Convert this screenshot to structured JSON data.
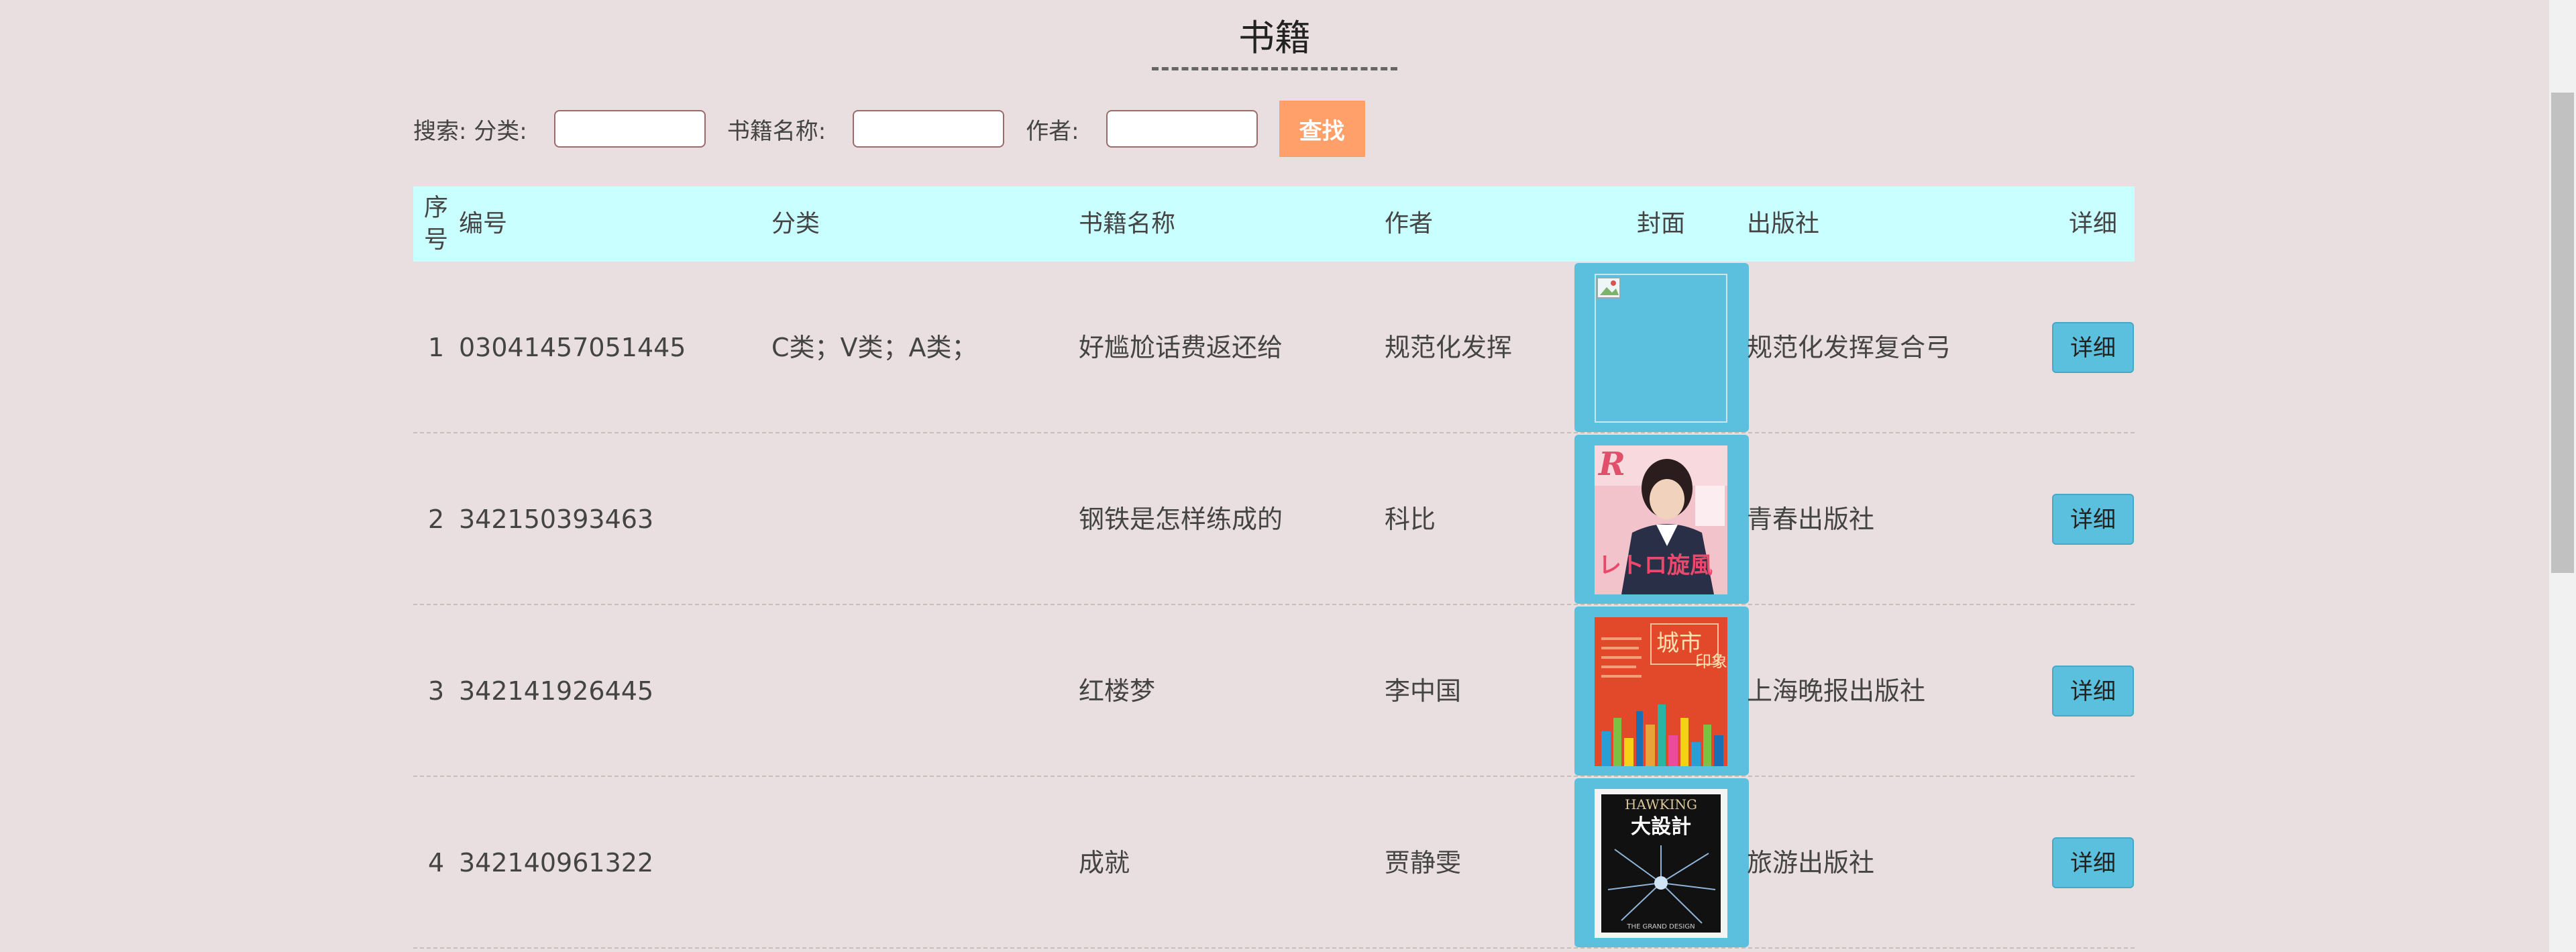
{
  "page": {
    "title": "书籍"
  },
  "search": {
    "prefix_label": "搜索: 分类:",
    "category_value": "",
    "name_label": "书籍名称:",
    "name_value": "",
    "author_label": "作者:",
    "author_value": "",
    "button_label": "查找"
  },
  "table": {
    "headers": {
      "seq": "序号",
      "code": "编号",
      "category": "分类",
      "name": "书籍名称",
      "author": "作者",
      "cover": "封面",
      "publisher": "出版社",
      "detail": "详细"
    },
    "rows": [
      {
        "seq": "1",
        "code": "03041457051445",
        "category": "C类；V类；A类；",
        "name": "好尴尬话费返还给",
        "author": "规范化发挥",
        "cover": "broken-image-icon",
        "publisher": "规范化发挥复合弓",
        "detail": "详细"
      },
      {
        "seq": "2",
        "code": "342150393463",
        "category": "",
        "name": "钢铁是怎样练成的",
        "author": "科比",
        "cover": "magazine-cover-portrait",
        "publisher": "青春出版社",
        "detail": "详细"
      },
      {
        "seq": "3",
        "code": "342141926445",
        "category": "",
        "name": "红楼梦",
        "author": "李中国",
        "cover": "city-impression-cover",
        "publisher": "上海晚报出版社",
        "detail": "详细"
      },
      {
        "seq": "4",
        "code": "342140961322",
        "category": "",
        "name": "成就",
        "author": "贾静雯",
        "cover": "grand-design-cover",
        "publisher": "旅游出版社",
        "detail": "详细"
      }
    ]
  },
  "colors": {
    "background": "#eadfe0",
    "header_bg": "#caffff",
    "search_button": "#ffa06b",
    "cover_bg": "#5bc0de",
    "detail_button": "#5bc0de"
  }
}
